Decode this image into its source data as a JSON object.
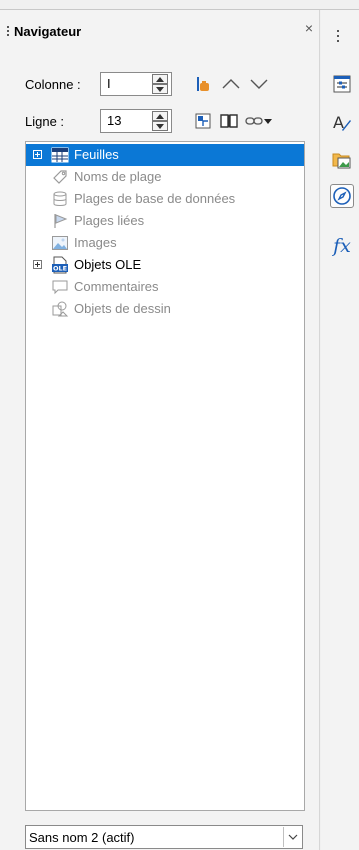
{
  "navigator": {
    "title": "Navigateur",
    "close_glyph": "×",
    "column": {
      "label": "Colonne :",
      "value": "I"
    },
    "row": {
      "label": "Ligne :",
      "value": "13"
    }
  },
  "toolbar_icons": [
    "data-range-icon",
    "previous-arrow-icon",
    "next-arrow-icon",
    "toggle-icon",
    "scenarios-book-icon",
    "drag-mode-link-icon",
    "dropdown-arrow-icon"
  ],
  "tree": [
    {
      "label": "Feuilles",
      "icon": "sheets-icon",
      "expandable": true,
      "selected": true,
      "dim": false
    },
    {
      "label": "Noms de plage",
      "icon": "range-names-icon",
      "expandable": false,
      "selected": false,
      "dim": true
    },
    {
      "label": "Plages de base de données",
      "icon": "database-ranges-icon",
      "expandable": false,
      "selected": false,
      "dim": true
    },
    {
      "label": "Plages liées",
      "icon": "linked-ranges-icon",
      "expandable": false,
      "selected": false,
      "dim": true
    },
    {
      "label": "Images",
      "icon": "images-icon",
      "expandable": false,
      "selected": false,
      "dim": true
    },
    {
      "label": "Objets OLE",
      "icon": "ole-objects-icon",
      "expandable": true,
      "selected": false,
      "dim": false
    },
    {
      "label": "Commentaires",
      "icon": "comments-icon",
      "expandable": false,
      "selected": false,
      "dim": true
    },
    {
      "label": "Objets de dessin",
      "icon": "drawing-objects-icon",
      "expandable": false,
      "selected": false,
      "dim": true
    }
  ],
  "document_select": {
    "value": "Sans nom 2 (actif)"
  },
  "sidebar": {
    "icons": [
      "properties-icon",
      "styles-icon",
      "gallery-icon",
      "navigator-icon",
      "functions-icon"
    ],
    "active": "navigator-icon",
    "fx_label": "fx"
  },
  "colors": {
    "selection": "#0b78d6",
    "accent_orange": "#e8902a",
    "accent_blue": "#1c5fb8"
  }
}
